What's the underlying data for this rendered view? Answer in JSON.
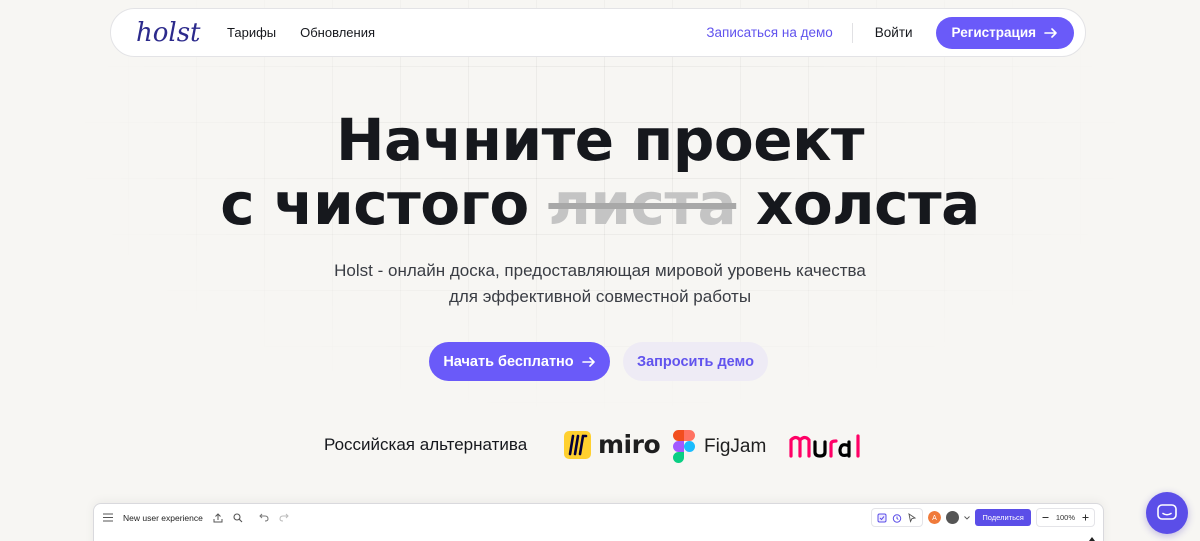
{
  "nav": {
    "logo_text": "holst",
    "links": [
      "Тарифы",
      "Обновления"
    ],
    "demo_link": "Записаться на демо",
    "login": "Войти",
    "register": "Регистрация"
  },
  "hero": {
    "title_line1": "Начните проект",
    "title_line2_prefix": "с чистого",
    "title_line2_struck": "листа",
    "title_line2_suffix": "холста",
    "subtitle_line1": "Holst - онлайн доска, предоставляющая мировой уровень качества",
    "subtitle_line2": "для эффективной совместной работы",
    "cta_start": "Начать бесплатно",
    "cta_demo": "Запросить демо"
  },
  "alternatives": {
    "label": "Российская альтернатива",
    "brands": [
      "miro",
      "FigJam",
      "mural"
    ]
  },
  "preview": {
    "board_title": "New user experience",
    "share": "Поделиться",
    "zoom": "100%",
    "avatar_initial": "А"
  },
  "colors": {
    "accent": "#6a5af9",
    "accent_text": "#6153ee",
    "background": "#f7f6f3",
    "demo_button_bg": "#eeebf5"
  },
  "icons": [
    "arrow-right-icon",
    "menu-icon",
    "upload-icon",
    "search-icon",
    "undo-icon",
    "redo-icon",
    "checkbox-icon",
    "timer-icon",
    "cursor-icon",
    "chevron-down-icon",
    "minus-icon",
    "plus-icon",
    "chat-icon"
  ]
}
